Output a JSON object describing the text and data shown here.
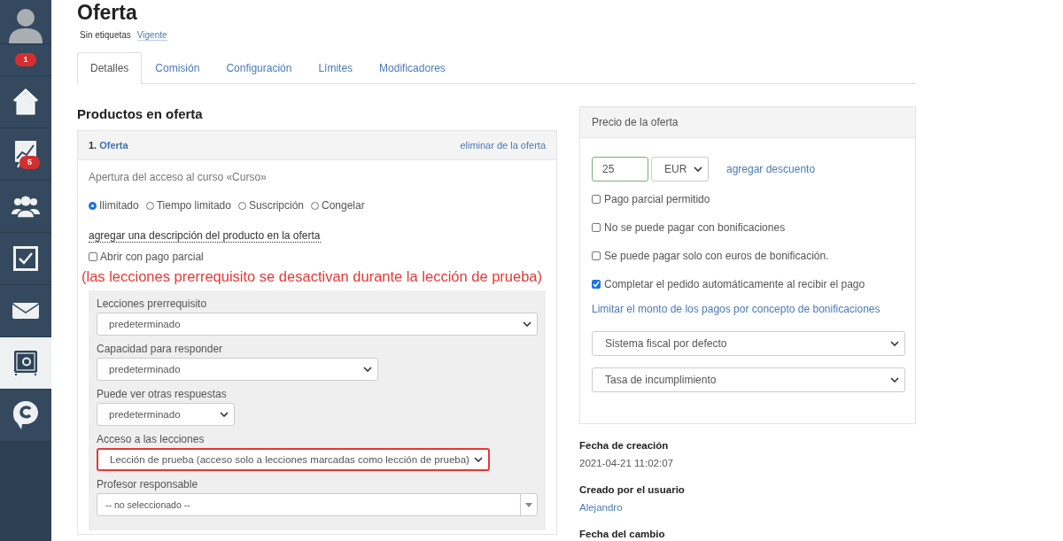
{
  "sidebar": {
    "items": [
      {
        "kind": "avatar",
        "selected": false
      },
      {
        "kind": "notifications",
        "badge": "1",
        "selected": false
      },
      {
        "kind": "home",
        "selected": false
      },
      {
        "kind": "chart",
        "badge": "5",
        "selected": false
      },
      {
        "kind": "users",
        "selected": false
      },
      {
        "kind": "tasks",
        "selected": false
      },
      {
        "kind": "mail",
        "selected": false
      },
      {
        "kind": "safe",
        "selected": true
      },
      {
        "kind": "chat",
        "selected": false
      }
    ]
  },
  "title": "Oferta",
  "tags": {
    "label": "Sin etiquetas",
    "status": "Vigente"
  },
  "tabs": [
    {
      "label": "Detalles",
      "selected": true
    },
    {
      "label": "Comisión",
      "selected": false
    },
    {
      "label": "Configuración",
      "selected": false
    },
    {
      "label": "Límites",
      "selected": false
    },
    {
      "label": "Modificadores",
      "selected": false
    }
  ],
  "products": {
    "heading": "Productos en oferta",
    "card": {
      "number": "1.",
      "name": "Oferta",
      "remove": "eliminar de la oferta",
      "access_title": "Apertura del acceso al curso «Curso»",
      "access_options": [
        {
          "label": "Ilimitado",
          "selected": true
        },
        {
          "label": "Tiempo limitado",
          "selected": false
        },
        {
          "label": "Suscripción",
          "selected": false
        },
        {
          "label": "Congelar",
          "selected": false
        }
      ],
      "description_link": "agregar una descripción del producto en la oferta",
      "partial_open": {
        "label": "Abrir con pago parcial",
        "checked": false
      },
      "annotation": "(las lecciones prerrequisito se desactivan durante la lección de prueba)",
      "settings": [
        {
          "label": "Lecciones prerrequisito",
          "value": "predeterminado",
          "kind": "select",
          "highlighted": false
        },
        {
          "label": "Capacidad para responder",
          "value": "predeterminado",
          "kind": "select",
          "highlighted": false
        },
        {
          "label": "Puede ver otras respuestas",
          "value": "predeterminado",
          "kind": "select",
          "highlighted": false
        },
        {
          "label": "Acceso a las lecciones",
          "value": "Lección de prueba (acceso solo a lecciones marcadas como lección de prueba)",
          "kind": "select",
          "highlighted": true
        },
        {
          "label": "Profesor responsable",
          "value": "-- no seleccionado --",
          "kind": "combo",
          "highlighted": false
        }
      ]
    }
  },
  "price": {
    "title": "Precio de la oferta",
    "amount": "25",
    "currency": "EUR",
    "discount_link": "agregar descuento",
    "options": [
      {
        "label": "Pago parcial permitido",
        "checked": false
      },
      {
        "label": "No se puede pagar con bonificaciones",
        "checked": false
      },
      {
        "label": "Se puede pagar solo con euros de bonificación.",
        "checked": false
      },
      {
        "label": "Completar el pedido automáticamente al recibir el pago",
        "checked": true
      }
    ],
    "limit_link": "Limitar el monto de los pagos por concepto de bonificaciones",
    "selects": [
      "Sistema fiscal por defecto",
      "Tasa de incumplimiento"
    ]
  },
  "meta": [
    {
      "label": "Fecha de creación",
      "value": "2021-04-21 11:02:07",
      "kind": "text"
    },
    {
      "label": "Creado por el usuario",
      "value": "Alejandro",
      "kind": "link"
    },
    {
      "label": "Fecha del cambio"
    }
  ]
}
